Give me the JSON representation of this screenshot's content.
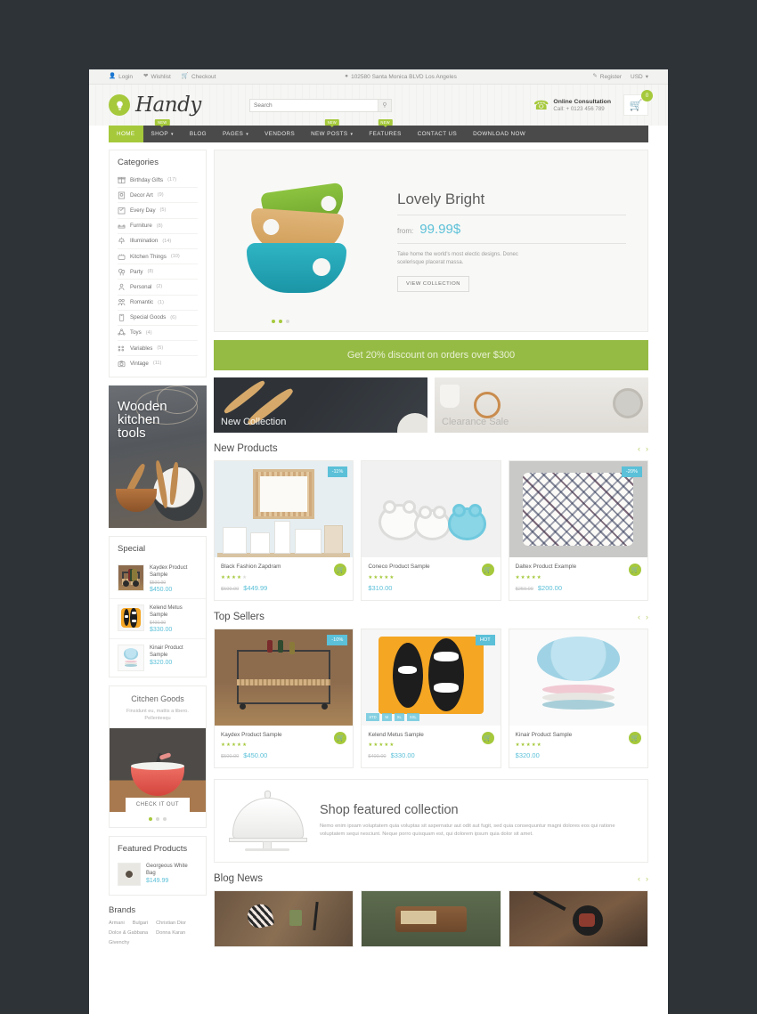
{
  "topbar": {
    "left_items": [
      {
        "icon": "user-icon",
        "label": "Login"
      },
      {
        "icon": "heart-icon",
        "label": "Wishlist"
      },
      {
        "icon": "cart-icon",
        "label": "Checkout"
      }
    ],
    "address_icon": "location-pin-icon",
    "address": "102580 Santa Monica BLVD Los Angeles",
    "register_icon": "pencil-icon",
    "register": "Register",
    "currency": "USD",
    "currency_caret": "▾"
  },
  "header": {
    "logo_text": "Handy",
    "logo_icon": "lightbulb-icon",
    "search_placeholder": "Search",
    "search_value": "",
    "search_icon": "search-icon",
    "phone_icon": "phone-icon",
    "consult_title": "Online Consultation",
    "consult_sub": "Call: + 0123 456 789",
    "cart_icon": "shopping-cart-icon",
    "cart_count": "0"
  },
  "nav": {
    "items": [
      {
        "label": "HOME",
        "active": true,
        "caret": "",
        "badge": ""
      },
      {
        "label": "SHOP",
        "active": false,
        "caret": "▾",
        "badge": "NEW"
      },
      {
        "label": "BLOG",
        "active": false,
        "caret": "",
        "badge": ""
      },
      {
        "label": "PAGES",
        "active": false,
        "caret": "▾",
        "badge": ""
      },
      {
        "label": "VENDORS",
        "active": false,
        "caret": "",
        "badge": ""
      },
      {
        "label": "NEW POSTS",
        "active": false,
        "caret": "▾",
        "badge": "NEW"
      },
      {
        "label": "FEATURES",
        "active": false,
        "caret": "",
        "badge": "NEW"
      },
      {
        "label": "CONTACT US",
        "active": false,
        "caret": "",
        "badge": ""
      },
      {
        "label": "DOWNLOAD NOW",
        "active": false,
        "caret": "",
        "badge": ""
      }
    ]
  },
  "sidebar": {
    "categories_title": "Categories",
    "categories": [
      {
        "icon": "gift-icon",
        "label": "Birthday Gifts",
        "count": "(17)"
      },
      {
        "icon": "picture-frame-icon",
        "label": "Decor Art",
        "count": "(9)"
      },
      {
        "icon": "calendar-icon",
        "label": "Every Day",
        "count": "(5)"
      },
      {
        "icon": "sofa-icon",
        "label": "Furniture",
        "count": "(8)"
      },
      {
        "icon": "lamp-icon",
        "label": "Illumination",
        "count": "(14)"
      },
      {
        "icon": "toaster-icon",
        "label": "Kitchen Things",
        "count": "(10)"
      },
      {
        "icon": "balloons-icon",
        "label": "Party",
        "count": "(8)"
      },
      {
        "icon": "person-icon",
        "label": "Personal",
        "count": "(2)"
      },
      {
        "icon": "couple-icon",
        "label": "Romantic",
        "count": "(1)"
      },
      {
        "icon": "box-icon",
        "label": "Special Goods",
        "count": "(6)"
      },
      {
        "icon": "robot-icon",
        "label": "Toys",
        "count": "(4)"
      },
      {
        "icon": "dots-icon",
        "label": "Variables",
        "count": "(5)"
      },
      {
        "icon": "camera-icon",
        "label": "Vintage",
        "count": "(11)"
      }
    ],
    "banner_text": "Wooden\nkitchen\ntools",
    "special_title": "Special",
    "special_items": [
      {
        "name": "Kaydex Product Sample",
        "old": "$500.00",
        "price": "$450.00",
        "art": "cart"
      },
      {
        "name": "Kelend Metus Sample",
        "old": "$400.00",
        "price": "$330.00",
        "art": "orange"
      },
      {
        "name": "Kinair Product Sample",
        "old": "",
        "price": "$320.00",
        "art": "plate"
      }
    ],
    "promo_title": "Citchen Goods",
    "promo_sub": "Finsidunt eu, mattis a libero. Pellentesqu",
    "promo_button": "CHECK IT OUT",
    "featured_title": "Featured Products",
    "featured_item": {
      "name": "Georgeous White Bag",
      "price": "$149.99"
    },
    "brands_title": "Brands",
    "brands": [
      "Armani",
      "Bulgari",
      "Christian Dior",
      "Dolce & Gabbana",
      "Donna Karan",
      "Givenchy"
    ]
  },
  "slider": {
    "title": "Lovely Bright",
    "from_label": "from:",
    "price": "99.99$",
    "description": "Take home the world's most electic designs. Donec scelerisque placerat massa.",
    "button": "VIEW COLLECTION"
  },
  "green_bar": {
    "text": "Get 20% discount on orders over $300"
  },
  "banners": [
    {
      "label": "New Collection"
    },
    {
      "label": "Clearance Sale"
    }
  ],
  "new_products": {
    "title": "New Products",
    "prev_icon": "chevron-left-icon",
    "next_icon": "chevron-right-icon",
    "items": [
      {
        "name": "Black Fashion Zapdram",
        "badge": "-11%",
        "stars": 4,
        "old": "$500.00",
        "price": "$449.99",
        "art": "frame"
      },
      {
        "name": "Coneco Product Sample",
        "badge": "",
        "stars": 5,
        "old": "",
        "price": "$310.00",
        "art": "clock"
      },
      {
        "name": "Daltex Product Example",
        "badge": "-20%",
        "stars": 5,
        "old": "$250.00",
        "price": "$200.00",
        "art": "pillow"
      }
    ]
  },
  "top_sellers": {
    "title": "Top Sellers",
    "prev_icon": "chevron-left-icon",
    "next_icon": "chevron-right-icon",
    "items": [
      {
        "name": "Kaydex Product Sample",
        "badge": "-10%",
        "stars": 5,
        "old": "$500.00",
        "price": "$450.00",
        "art": "cart",
        "swatches": []
      },
      {
        "name": "Kelend Metus Sample",
        "badge": "HOT",
        "stars": 5,
        "old": "$400.00",
        "price": "$330.00",
        "art": "orange",
        "swatches": [
          "STD",
          "M",
          "XL",
          "XXL"
        ]
      },
      {
        "name": "Kinair Product Sample",
        "badge": "",
        "stars": 5,
        "old": "",
        "price": "$320.00",
        "art": "plate",
        "swatches": []
      }
    ]
  },
  "feature_band": {
    "icon": "cake-dome-icon",
    "title": "Shop featured collection",
    "description": "Nemo enim ipsam voluptatem quia voluptas sit aspernatur aut odit aut fugit, sed quia consequuntur magni dolores eos qui ratione voluptatem sequi nesciunt. Neque porro quisquam est, qui dolorem ipsum quia dolor sit amet."
  },
  "blog_news": {
    "title": "Blog News",
    "prev_icon": "chevron-left-icon",
    "next_icon": "chevron-right-icon",
    "items": [
      {
        "art": "gift"
      },
      {
        "art": "radio"
      },
      {
        "art": "pan"
      }
    ]
  },
  "colors": {
    "accent_green": "#a5c93b",
    "accent_blue": "#5bc0d8",
    "nav_dark": "#4a4a4a",
    "band_green": "#96bb44"
  }
}
